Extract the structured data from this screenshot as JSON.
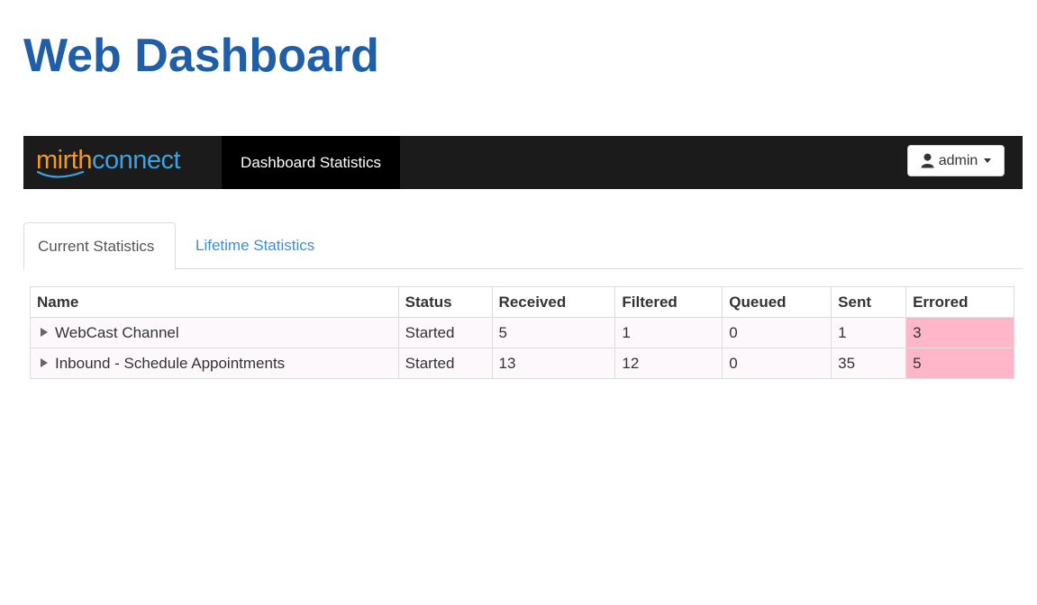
{
  "slide": {
    "title": "Web Dashboard"
  },
  "navbar": {
    "logo": {
      "part1": "mirth",
      "part2": "connect"
    },
    "active_tab": "Dashboard Statistics",
    "user_button": {
      "label": "admin",
      "icon": "user-icon"
    }
  },
  "tabs": [
    {
      "label": "Current Statistics",
      "active": true
    },
    {
      "label": "Lifetime Statistics",
      "active": false
    }
  ],
  "table": {
    "headers": [
      "Name",
      "Status",
      "Received",
      "Filtered",
      "Queued",
      "Sent",
      "Errored"
    ],
    "rows": [
      {
        "name": "WebCast Channel",
        "status": "Started",
        "received": "5",
        "filtered": "1",
        "queued": "0",
        "sent": "1",
        "errored": "3"
      },
      {
        "name": "Inbound - Schedule Appointments",
        "status": "Started",
        "received": "13",
        "filtered": "12",
        "queued": "0",
        "sent": "35",
        "errored": "5"
      }
    ]
  },
  "colors": {
    "title": "#1f5ea8",
    "navbar_bg": "#1b1b1b",
    "logo_mirth": "#f39a1f",
    "logo_connect": "#3aa3e3",
    "link": "#3a8fd6",
    "errored_bg": "#ffb6c8"
  }
}
